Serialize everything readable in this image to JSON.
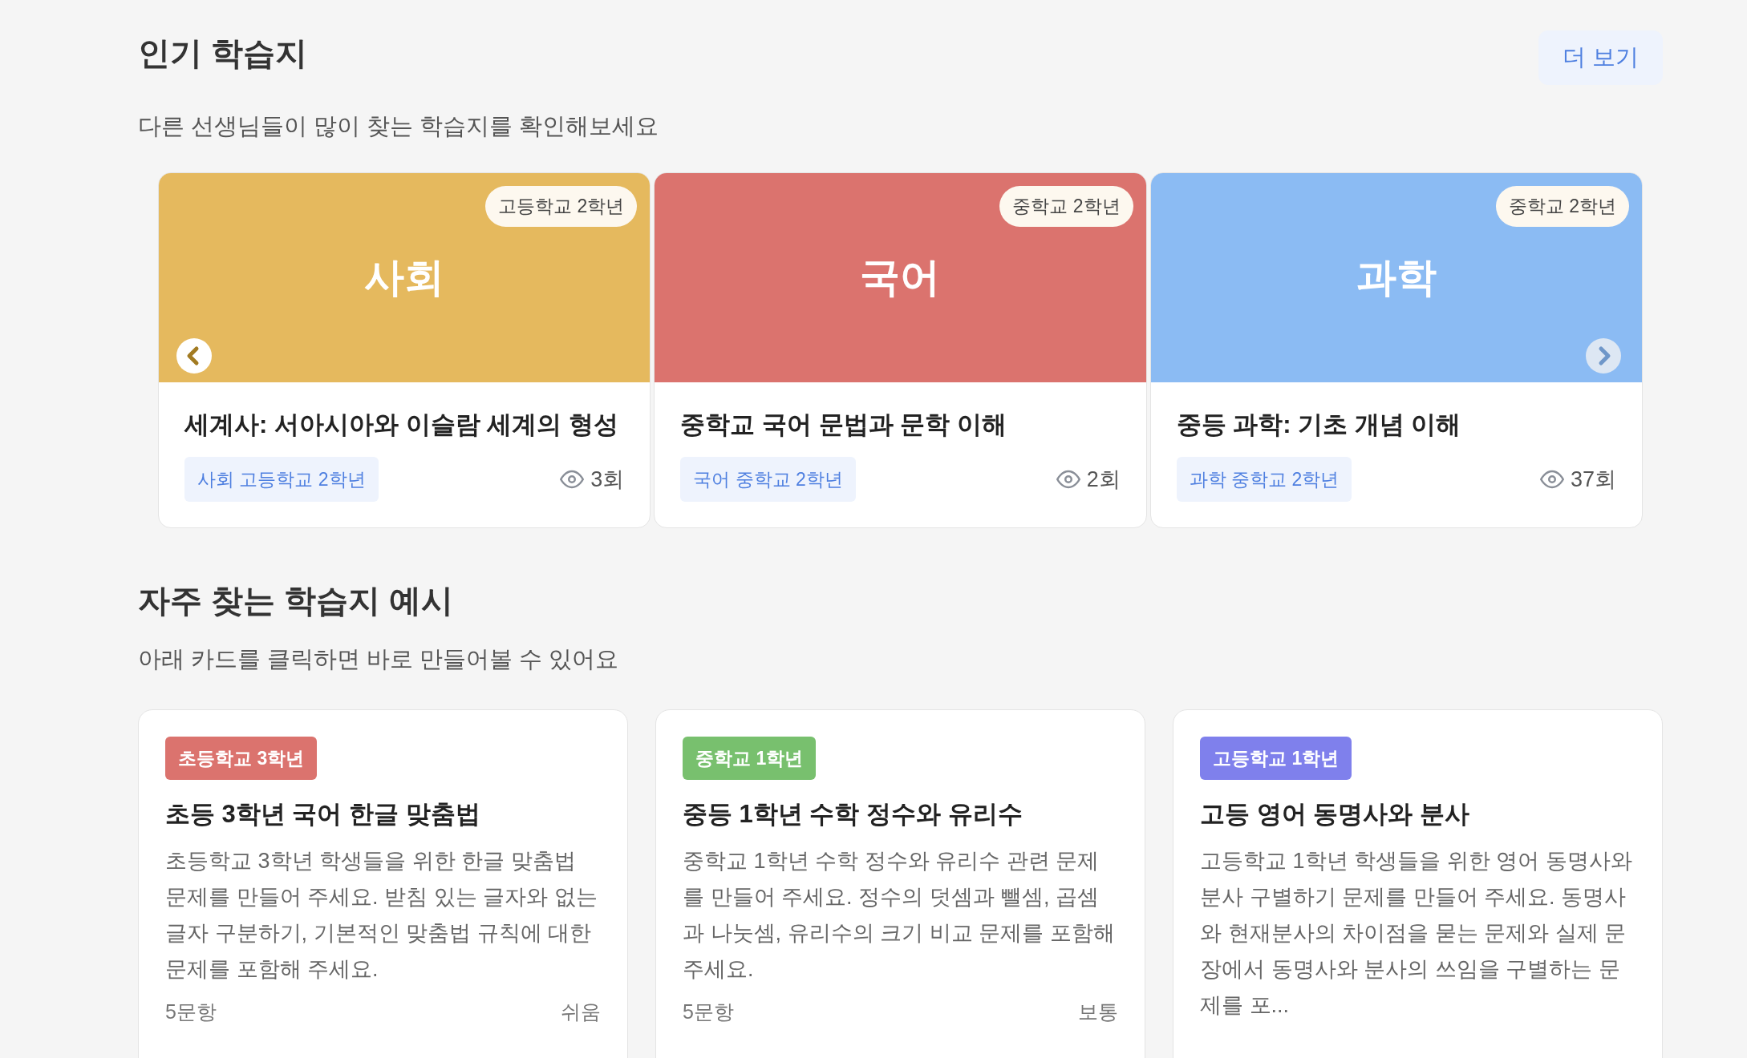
{
  "popular": {
    "title": "인기 학습지",
    "more_button": "더 보기",
    "subtitle": "다른 선생님들이 많이 찾는 학습지를 확인해보세요",
    "cards": [
      {
        "grade_badge": "고등학교 2학년",
        "subject": "사회",
        "color": "#e5b95e",
        "title": "세계사: 서아시아와 이슬람 세계의 형성",
        "tag": "사회 고등학교 2학년",
        "views": "3회"
      },
      {
        "grade_badge": "중학교 2학년",
        "subject": "국어",
        "color": "#db736e",
        "title": "중학교 국어 문법과 문학 이해",
        "tag": "국어 중학교 2학년",
        "views": "2회"
      },
      {
        "grade_badge": "중학교 2학년",
        "subject": "과학",
        "color": "#8bbbf3",
        "title": "중등 과학: 기초 개념 이해",
        "tag": "과학 중학교 2학년",
        "views": "37회"
      }
    ]
  },
  "examples": {
    "title": "자주 찾는 학습지 예시",
    "subtitle": "아래 카드를 클릭하면 바로 만들어볼 수 있어요",
    "cards": [
      {
        "badge": "초등학교 3학년",
        "color": "#db736e",
        "title": "초등 3학년 국어 한글 맞춤법",
        "description": "초등학교 3학년 학생들을 위한 한글 맞춤법 문제를 만들어 주세요. 받침 있는 글자와 없는 글자 구분하기, 기본적인 맞춤법 규칙에 대한 문제를 포함해 주세요.",
        "count": "5문항",
        "difficulty": "쉬움"
      },
      {
        "badge": "중학교 1학년",
        "color": "#78c06e",
        "title": "중등 1학년 수학 정수와 유리수",
        "description": "중학교 1학년 수학 정수와 유리수 관련 문제를 만들어 주세요. 정수의 덧셈과 뺄셈, 곱셈과 나눗셈, 유리수의 크기 비교 문제를 포함해 주세요.",
        "count": "5문항",
        "difficulty": "보통"
      },
      {
        "badge": "고등학교 1학년",
        "color": "#7f80ec",
        "title": "고등 영어 동명사와 분사",
        "description": "고등학교 1학년 학생들을 위한 영어 동명사와 분사 구별하기 문제를 만들어 주세요. 동명사와 현재분사의 차이점을 묻는 문제와 실제 문장에서 동명사와 분사의 쓰임을 구별하는 문제를 포..."
      }
    ]
  }
}
